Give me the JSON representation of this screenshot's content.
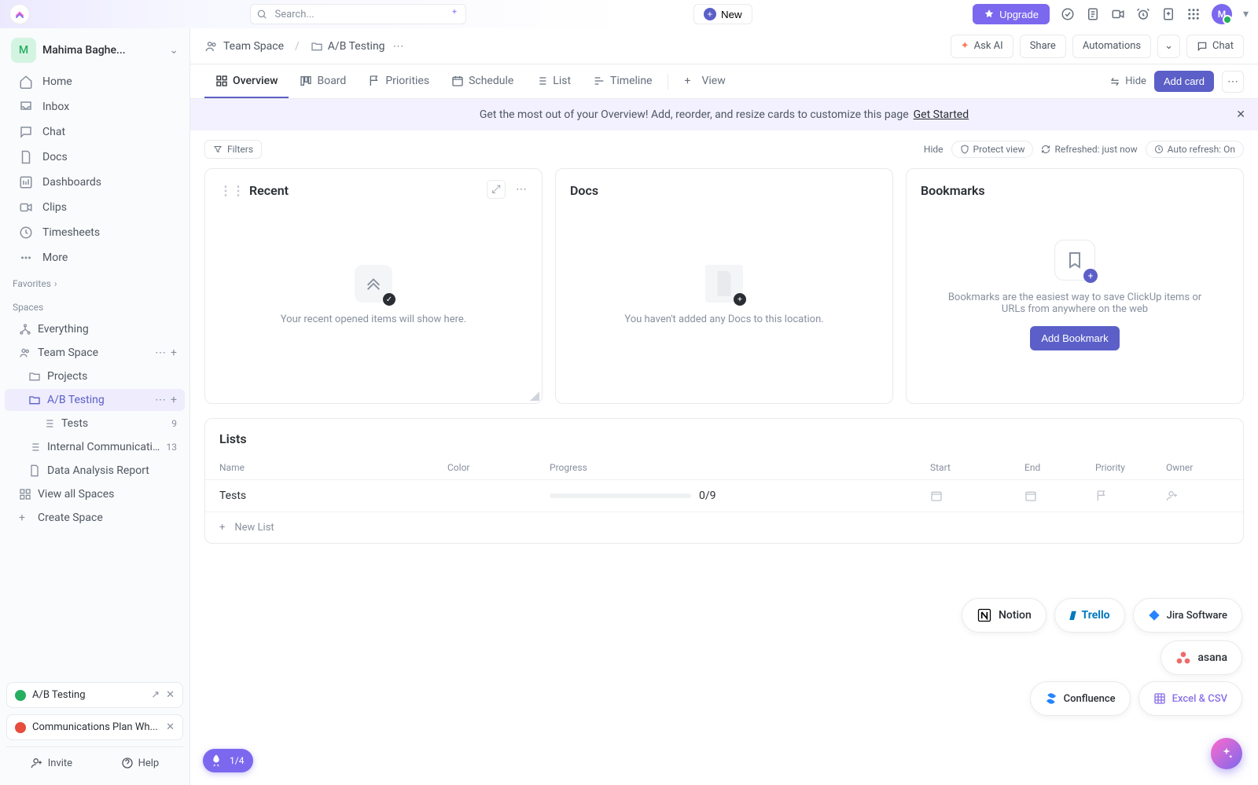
{
  "top": {
    "search_placeholder": "Search...",
    "new_label": "New",
    "upgrade_label": "Upgrade",
    "avatar_initial": "M"
  },
  "sidebar": {
    "user_initial": "M",
    "user_name": "Mahima Baghe...",
    "nav": [
      {
        "label": "Home",
        "icon": "home"
      },
      {
        "label": "Inbox",
        "icon": "inbox"
      },
      {
        "label": "Chat",
        "icon": "chat"
      },
      {
        "label": "Docs",
        "icon": "doc"
      },
      {
        "label": "Dashboards",
        "icon": "dashboard"
      },
      {
        "label": "Clips",
        "icon": "clip"
      },
      {
        "label": "Timesheets",
        "icon": "clock"
      },
      {
        "label": "More",
        "icon": "more"
      }
    ],
    "favorites_label": "Favorites",
    "spaces_label": "Spaces",
    "everything_label": "Everything",
    "team_space_label": "Team Space",
    "projects_label": "Projects",
    "ab_testing_label": "A/B Testing",
    "tests_label": "Tests",
    "tests_count": "9",
    "internal_comm_label": "Internal Communicati...",
    "internal_comm_count": "13",
    "data_analysis_label": "Data Analysis Report",
    "view_all_spaces_label": "View all Spaces",
    "create_space_label": "Create Space",
    "pill1_label": "A/B Testing",
    "pill2_label": "Communications Plan Wh...",
    "invite_label": "Invite",
    "help_label": "Help"
  },
  "crumb": {
    "space": "Team Space",
    "folder": "A/B Testing"
  },
  "actions": {
    "ask_ai": "Ask AI",
    "share": "Share",
    "automations": "Automations",
    "chat": "Chat"
  },
  "tabs": {
    "items": [
      "Overview",
      "Board",
      "Priorities",
      "Schedule",
      "List",
      "Timeline"
    ],
    "view_label": "View",
    "hide_label": "Hide",
    "add_card_label": "Add card"
  },
  "banner": {
    "text": "Get the most out of your Overview! Add, reorder, and resize cards to customize this page",
    "link": "Get Started"
  },
  "toolbar": {
    "filters_label": "Filters",
    "hide_label": "Hide",
    "protect_view_label": "Protect view",
    "refreshed_label": "Refreshed: just now",
    "auto_refresh_label": "Auto refresh: On"
  },
  "cards": {
    "recent_title": "Recent",
    "recent_empty": "Your recent opened items will show here.",
    "docs_title": "Docs",
    "docs_empty": "You haven't added any Docs to this location.",
    "bookmarks_title": "Bookmarks",
    "bookmarks_text": "Bookmarks are the easiest way to save ClickUp items or URLs from anywhere on the web",
    "add_bookmark_label": "Add Bookmark"
  },
  "lists": {
    "title": "Lists",
    "headers": {
      "name": "Name",
      "color": "Color",
      "progress": "Progress",
      "start": "Start",
      "end": "End",
      "priority": "Priority",
      "owner": "Owner"
    },
    "rows": [
      {
        "name": "Tests",
        "progress": "0/9"
      }
    ],
    "new_list_label": "New List"
  },
  "imports": [
    "Notion",
    "Trello",
    "Jira Software",
    "asana",
    "Confluence",
    "Excel & CSV"
  ],
  "onboard": {
    "count": "1/4"
  }
}
